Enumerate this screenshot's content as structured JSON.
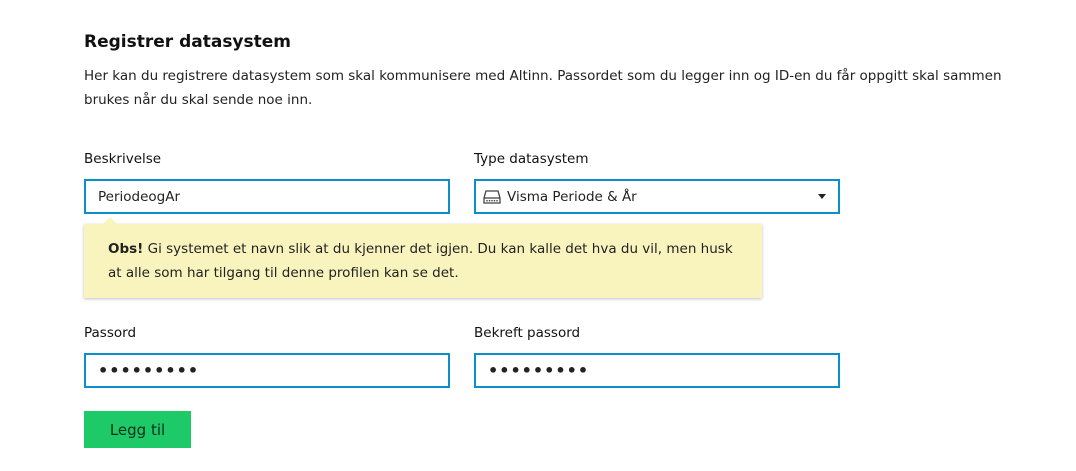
{
  "form": {
    "title": "Registrer datasystem",
    "intro": "Her kan du registrere datasystem som skal kommunisere med Altinn. Passordet som du legger inn og ID-en du får oppgitt skal sammen brukes når du skal sende noe inn.",
    "description": {
      "label": "Beskrivelse",
      "value": "PeriodeogAr"
    },
    "system_type": {
      "label": "Type datasystem",
      "selected": "Visma Periode & År",
      "icon": "drive-icon"
    },
    "help": {
      "strong": "Obs!",
      "text": " Gi systemet et navn slik at du kjenner det igjen. Du kan kalle det hva du vil, men husk at alle som har tilgang til denne profilen kan se det."
    },
    "password": {
      "label": "Passord",
      "masked": "•••••••••"
    },
    "confirm_password": {
      "label": "Bekreft passord",
      "masked": "•••••••••"
    },
    "submit_label": "Legg til"
  },
  "colors": {
    "field_border": "#0a8fcc",
    "help_background": "#f9f4be",
    "button": "#1eca68"
  }
}
